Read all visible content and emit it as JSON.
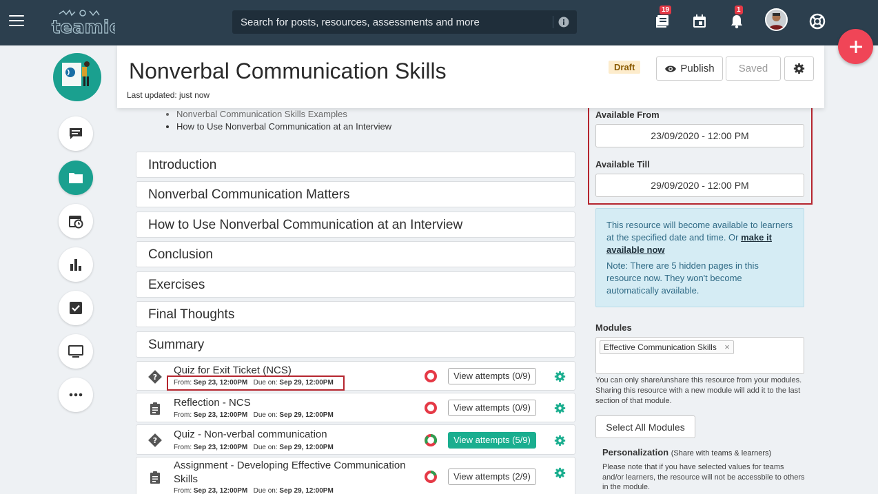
{
  "topbar": {
    "search_placeholder": "Search for posts, resources, assessments and more",
    "badges": {
      "posts": "19",
      "notifications": "1"
    }
  },
  "header": {
    "title": "Nonverbal Communication Skills",
    "last_updated": "Last updated: just now",
    "status": "Draft",
    "publish_label": "Publish",
    "saved_label": "Saved"
  },
  "content": {
    "bullets": [
      "Nonverbal Communication Skills Examples",
      "How to Use Nonverbal Communication at an Interview"
    ],
    "sections": [
      "Introduction",
      "Nonverbal Communication Matters",
      "How to Use Nonverbal Communication at an Interview",
      "Conclusion",
      "Exercises",
      "Final Thoughts",
      "Summary"
    ],
    "tasks": [
      {
        "title": "Quiz for Exit Ticket (NCS)",
        "from_label": "From:",
        "from": "Sep 23, 12:00PM",
        "due_label": "Due on:",
        "due": "Sep 29, 12:00PM",
        "button": "View attempts (0/9)",
        "icon": "quiz-icon"
      },
      {
        "title": "Reflection - NCS",
        "from_label": "From:",
        "from": "Sep 23, 12:00PM",
        "due_label": "Due on:",
        "due": "Sep 29, 12:00PM",
        "button": "View attempts (0/9)",
        "icon": "assignment-icon"
      },
      {
        "title": "Quiz - Non-verbal communication",
        "from_label": "From:",
        "from": "Sep 23, 12:00PM",
        "due_label": "Due on:",
        "due": "Sep 29, 12:00PM",
        "button": "View attempts (5/9)",
        "icon": "quiz-icon"
      },
      {
        "title": "Assignment - Developing Effective Communication",
        "title_line2": "Skills",
        "from_label": "From:",
        "from": "Sep 23, 12:00PM",
        "due_label": "Due on:",
        "due": "Sep 29, 12:00PM",
        "button": "View attempts (2/9)",
        "icon": "assignment-icon"
      }
    ]
  },
  "panel": {
    "available_from_label": "Available From",
    "available_from": "23/09/2020 - 12:00 PM",
    "available_till_label": "Available Till",
    "available_till": "29/09/2020 - 12:00 PM",
    "info_line": "This resource will become available to learners at the specified date and time. Or",
    "info_link": "make it available now",
    "info_note": "Note: There are 5 hidden pages in this resource now. They won't become automatically available.",
    "modules_label": "Modules",
    "module_chip": "Effective Communication Skills",
    "module_chip_remove": "×",
    "modules_help": "You can only share/unshare this resource from your modules. Sharing this resource with a new module will add it to the last section of that module.",
    "select_all": "Select All Modules",
    "personalization_title": "Personalization",
    "personalization_sub": "(Share with teams & learners)",
    "personalization_help": "Please note that if you have selected values for teams and/or learners, the resource will not be accessbile to others in the module."
  },
  "colors": {
    "topbar": "#2c3f4e",
    "accent": "#1aa08f",
    "fab": "#f04557",
    "highlight": "#b5252e"
  }
}
